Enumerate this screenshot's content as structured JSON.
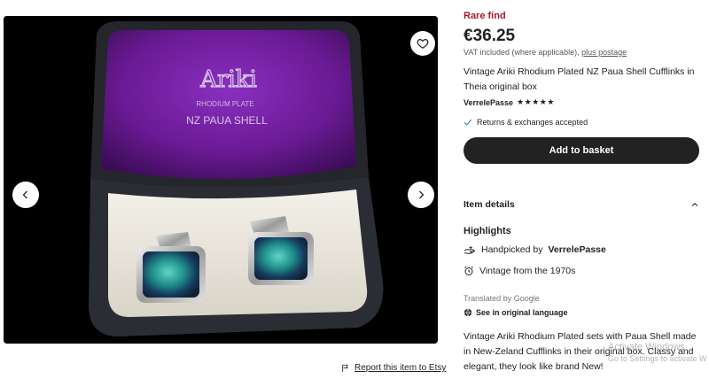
{
  "gallery": {
    "box_brand": "Ariki",
    "box_line1": "RHODIUM PLATE",
    "box_line2": "NZ PAUA SHELL",
    "report_label": "Report this item to Etsy"
  },
  "listing": {
    "rare_label": "Rare find",
    "price": "€36.25",
    "vat_text": "VAT included (where applicable),",
    "vat_link": "plus postage",
    "title": "Vintage Ariki Rhodium Plated NZ Paua Shell Cufflinks in Theia original box",
    "seller": "VerrelePasse",
    "stars": "★★★★★",
    "returns": "Returns & exchanges accepted",
    "basket_label": "Add to basket"
  },
  "details": {
    "section_label": "Item details",
    "highlights_label": "Highlights",
    "handpicked_prefix": "Handpicked by",
    "handpicked_seller": "VerrelePasse",
    "vintage": "Vintage from the 1970s",
    "translated": "Translated by Google",
    "original_language": "See in original language",
    "description": "Vintage Ariki Rhodium Plated sets with Paua Shell made in New-Zeland Cufflinks in their original box. Classy and elegant, they look like brand New!"
  },
  "watermark": {
    "line1": "Activate Windows",
    "line2": "Go to Settings to activate W"
  },
  "colors": {
    "rare": "#a61a2e",
    "button": "#222222",
    "lining": "#6a1a94",
    "background": "#000000"
  }
}
